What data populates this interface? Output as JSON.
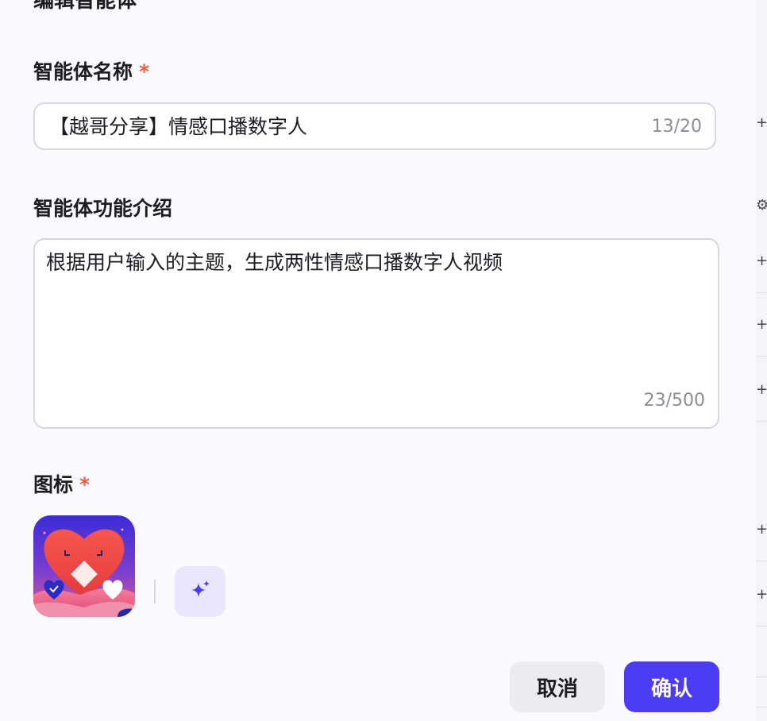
{
  "modal": {
    "title": "编辑智能体"
  },
  "name_field": {
    "label": "智能体名称",
    "required_mark": "*",
    "value": "【越哥分享】情感口播数字人",
    "counter": "13/20"
  },
  "description_field": {
    "label": "智能体功能介绍",
    "value": "根据用户输入的主题，生成两性情感口播数字人视频",
    "counter": "23/500"
  },
  "icon_field": {
    "label": "图标",
    "required_mark": "*",
    "thumbnail_icon": "heart-avatar-icon",
    "generate_icon": "sparkle-icon"
  },
  "footer": {
    "cancel_label": "取消",
    "confirm_label": "确认"
  },
  "colors": {
    "accent": "#4b3cf5",
    "required": "#f15a3c",
    "ai_button_bg": "#e9e6fd"
  }
}
